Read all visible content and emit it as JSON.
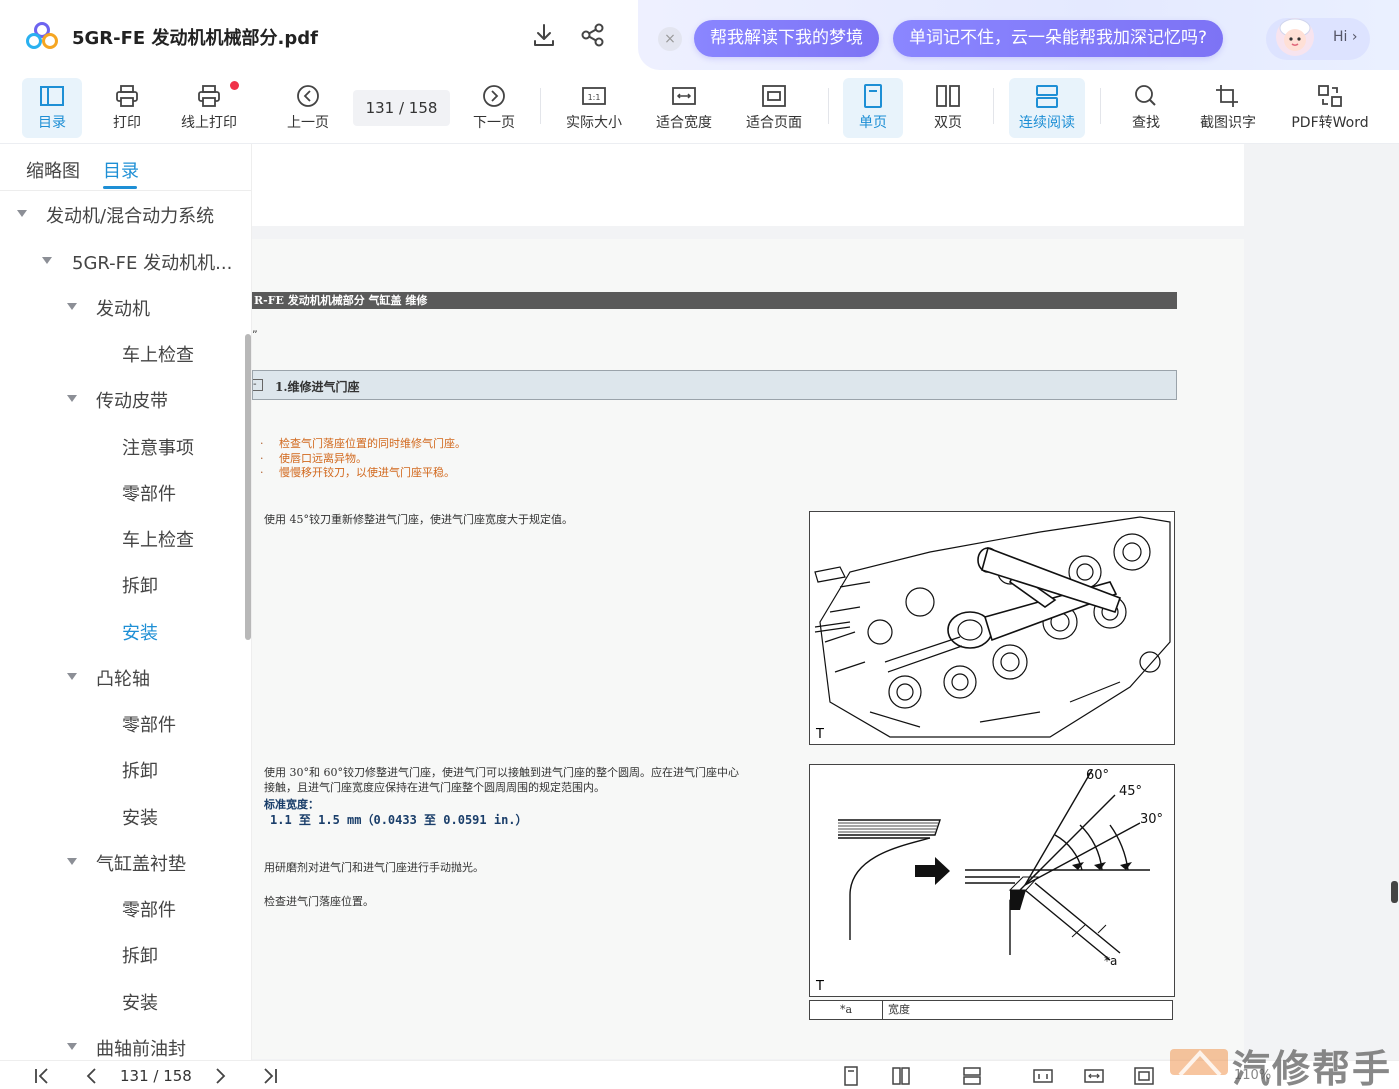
{
  "titlebar": {
    "doc_title": "5GR-FE 发动机机械部分.pdf",
    "icons": [
      "download-icon",
      "share-icon"
    ]
  },
  "ai_bar": {
    "close_icon": "×",
    "prompt_1": "帮我解读下我的梦境",
    "prompt_2": "单词记不住，云一朵能帮我加深记忆吗?",
    "hi_label": "Hi ›"
  },
  "toolbar": {
    "toc": "目录",
    "print": "打印",
    "online_print": "线上打印",
    "prev_page": "上一页",
    "page_indicator": "131 / 158",
    "next_page": "下一页",
    "actual_size": "实际大小",
    "fit_width": "适合宽度",
    "fit_page": "适合页面",
    "single_page": "单页",
    "double_page": "双页",
    "continuous": "连续阅读",
    "find": "查找",
    "ocr": "截图识字",
    "pdf_to_word": "PDF转Word",
    "icon_text_actual": "1:1"
  },
  "sidebar": {
    "tab_thumbnails": "缩略图",
    "tab_toc": "目录",
    "items": [
      {
        "label": "发动机/混合动力系统",
        "level": 0,
        "expanded": true
      },
      {
        "label": "5GR-FE 发动机机...",
        "level": 1,
        "expanded": true
      },
      {
        "label": "发动机",
        "level": 2,
        "expanded": true
      },
      {
        "label": "车上检查",
        "level": 3
      },
      {
        "label": "传动皮带",
        "level": 2,
        "expanded": true
      },
      {
        "label": "注意事项",
        "level": 3
      },
      {
        "label": "零部件",
        "level": 3
      },
      {
        "label": "车上检查",
        "level": 3
      },
      {
        "label": "拆卸",
        "level": 3
      },
      {
        "label": "安装",
        "level": 3,
        "active": true
      },
      {
        "label": "凸轮轴",
        "level": 2,
        "expanded": true
      },
      {
        "label": "零部件",
        "level": 3
      },
      {
        "label": "拆卸",
        "level": 3
      },
      {
        "label": "安装",
        "level": 3
      },
      {
        "label": "气缸盖衬垫",
        "level": 2,
        "expanded": true
      },
      {
        "label": "零部件",
        "level": 3
      },
      {
        "label": "拆卸",
        "level": 3
      },
      {
        "label": "安装",
        "level": 3
      },
      {
        "label": "曲轴前油封",
        "level": 2,
        "expanded": true
      }
    ]
  },
  "document": {
    "header": "R-FE 发动机机械部分  气缸盖  维修",
    "fragment_mark": "„",
    "section_title": "1.维修进气门座",
    "notes": [
      "检查气门落座位置的同时维修气门座。",
      "使唇口远离异物。",
      "慢慢移开铰刀，以使进气门座平稳。"
    ],
    "note_bullet": "·",
    "step_1": "使用 45°铰刀重新修整进气门座，使进气门座宽度大于规定值。",
    "step_2_line1": "使用 30°和 60°铰刀修整进气门座，使进气门可以接触到进气门座的整个圆周。应在进气门座中心",
    "step_2_line2": "接触，且进气门座宽度应保持在进气门座整个圆周周围的规定范围内。",
    "standard_label": "标准宽度：",
    "standard_value": "1.1 至 1.5 mm（0.0433 至 0.0591 in.）",
    "step_3": "用研磨剂对进气门和进气门座进行手动抛光。",
    "step_4": "检查进气门落座位置。",
    "figure_1_tag": "T",
    "figure_2_tag": "T",
    "angle_60": "60°",
    "angle_45": "45°",
    "angle_30": "30°",
    "dim_a": "*a",
    "legend_key": "*a",
    "legend_value": "宽度"
  },
  "bottombar": {
    "page_indicator": "131 / 158",
    "zoom": "110%",
    "watermark": "汽修帮手"
  },
  "colors": {
    "accent": "#1e8fd5",
    "active_bg": "#e8f3fb",
    "ai_pill": "#7d73f5",
    "note_orange": "#d2691e",
    "spec_blue": "#1a3e6a",
    "header_grey": "#5a5a5a",
    "section_bg": "#dde6ec"
  }
}
